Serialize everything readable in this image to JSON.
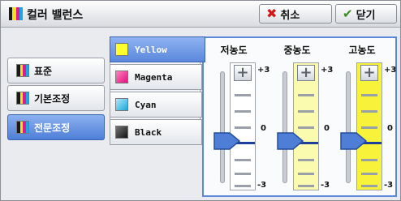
{
  "title": "컬러 밸런스",
  "buttons": {
    "cancel": "취소",
    "close": "닫기"
  },
  "modes": [
    {
      "label": "표준",
      "active": false
    },
    {
      "label": "기본조정",
      "active": false
    },
    {
      "label": "전문조정",
      "active": true
    }
  ],
  "colors": [
    {
      "label": "Yellow",
      "swatch": "#ffff2e",
      "active": true
    },
    {
      "label": "Magenta",
      "swatch": "#ff3c9c",
      "active": false
    },
    {
      "label": "Cyan",
      "swatch": "#5fd0f2",
      "active": false
    },
    {
      "label": "Black",
      "swatch": "#2a2a2a",
      "active": false
    }
  ],
  "density_columns": [
    {
      "label": "저농도",
      "value": 0,
      "bar_color": "#ffffff"
    },
    {
      "label": "중농도",
      "value": 0,
      "bar_color": "#fbfbb0"
    },
    {
      "label": "고농도",
      "value": 0,
      "bar_color": "#f7f23a"
    }
  ],
  "scale": {
    "max": "+3",
    "mid": "0",
    "min": "-3"
  },
  "colors_theme": {
    "accent": "#5b88dc",
    "cancel_red": "#d0191b",
    "check_green": "#3b8c1e"
  }
}
